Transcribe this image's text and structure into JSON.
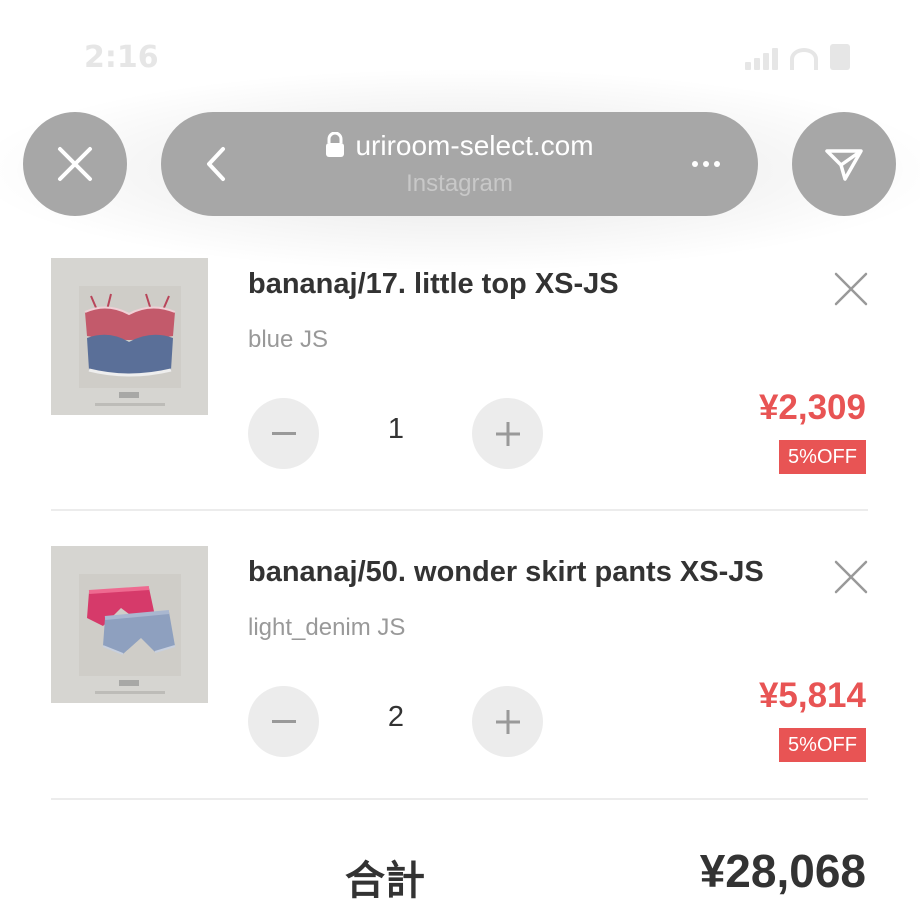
{
  "status_bar": {
    "time": "2:16"
  },
  "browser": {
    "url": "uriroom-select.com",
    "source": "Instagram",
    "icons": [
      "close-icon",
      "back-icon",
      "lock-icon",
      "more-icon",
      "share-icon"
    ]
  },
  "cart": {
    "items": [
      {
        "title": "bananaj/17. little top XS-JS",
        "variant": "blue JS",
        "quantity": "1",
        "price": "¥2,309",
        "discount": "5%OFF"
      },
      {
        "title": "bananaj/50. wonder skirt pants XS-JS",
        "variant": "light_denim JS",
        "quantity": "2",
        "price": "¥5,814",
        "discount": "5%OFF"
      }
    ],
    "total_label": "合計",
    "total_value": "¥28,068"
  },
  "colors": {
    "accent": "#e85454",
    "chrome": "#a7a7a7",
    "qty_button": "#ececec"
  }
}
